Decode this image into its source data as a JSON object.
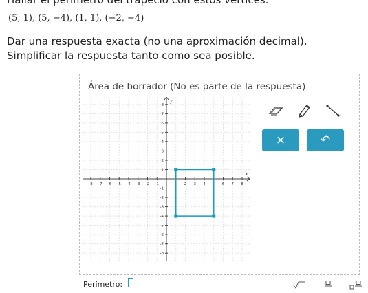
{
  "question": {
    "title": "Hallar el perímetro del trapecio con estos vértices.",
    "vertices": "(5, 1), (5, −4), (1, 1), (−2, −4)",
    "line1": "Dar una respuesta exacta (no una aproximación decimal).",
    "line2": "Simplificar la respuesta tanto como sea posible."
  },
  "scratch": {
    "label": "Área de borrador (No es parte de la respuesta)",
    "graph": {
      "x_axis_label": "x",
      "y_axis_label": "y",
      "x_ticks": [
        "-8",
        "-7",
        "-6",
        "-5",
        "-4",
        "-3",
        "-2",
        "-1",
        "2",
        "3",
        "4",
        "6",
        "7",
        "8"
      ],
      "y_ticks": [
        "8",
        "7",
        "6",
        "5",
        "4",
        "3",
        "2",
        "1",
        "-1",
        "-2",
        "-3",
        "-4",
        "-5",
        "-6",
        "-7",
        "-8"
      ],
      "xlim": [
        -8.8,
        8.8
      ],
      "ylim": [
        -8.8,
        8.8
      ],
      "drawn_points": [
        [
          1,
          1
        ],
        [
          5,
          1
        ],
        [
          5,
          -4
        ],
        [
          1,
          -4
        ]
      ],
      "point_color": "#1a9bbf",
      "line_color": "#1a9bbf"
    },
    "tools": [
      {
        "name": "eraser-tool",
        "icon": "eraser-icon"
      },
      {
        "name": "pencil-tool",
        "icon": "pencil-icon"
      },
      {
        "name": "line-tool",
        "icon": "line-segment-icon"
      }
    ],
    "buttons": {
      "clear_label": "×",
      "undo_label": "↶",
      "color": "#2a9bbf"
    }
  },
  "answer": {
    "label": "Perímetro:",
    "value": ""
  },
  "math_tools": [
    {
      "name": "sqrt-button",
      "icon": "square-root-icon"
    },
    {
      "name": "fraction-button",
      "icon": "fraction-icon"
    },
    {
      "name": "mixed-number-button",
      "icon": "mixed-number-icon"
    }
  ]
}
